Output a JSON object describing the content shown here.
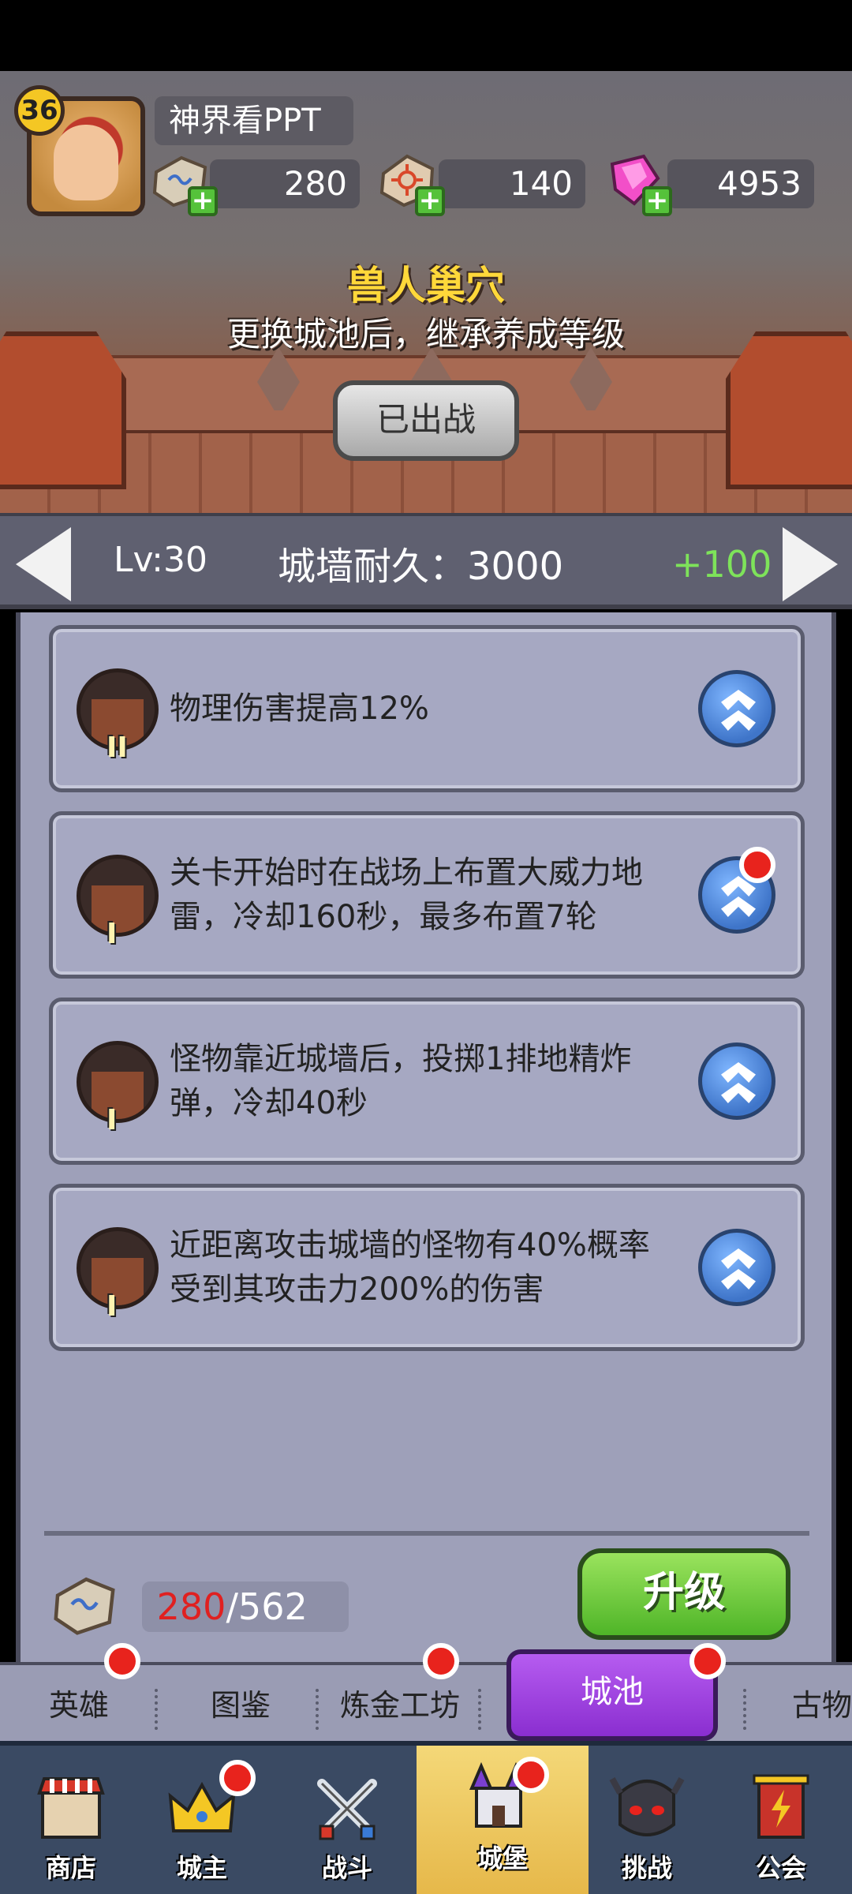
{
  "player": {
    "level": "36",
    "name": "神界看PPT"
  },
  "resources": [
    {
      "icon": "rune-stone-icon",
      "value": "280"
    },
    {
      "icon": "sun-stone-icon",
      "value": "140"
    },
    {
      "icon": "pink-gem-icon",
      "value": "4953"
    }
  ],
  "castle": {
    "title": "兽人巢穴",
    "subtitle": "更换城池后，继承养成等级",
    "deploy_label": "已出战"
  },
  "levelbar": {
    "level": "Lv:30",
    "wall": "城墙耐久：3000",
    "bonus": "+100"
  },
  "perks": [
    {
      "tier": "II",
      "text": "物理伤害提高12%",
      "has_dot": false
    },
    {
      "tier": "I",
      "text": "关卡开始时在战场上布置大威力地雷，冷却160秒，最多布置7轮",
      "has_dot": true
    },
    {
      "tier": "I",
      "text": "怪物靠近城墙后，投掷1排地精炸弹，冷却40秒",
      "has_dot": false
    },
    {
      "tier": "I",
      "text": "近距离攻击城墙的怪物有40%概率受到其攻击力200%的伤害",
      "has_dot": false
    }
  ],
  "upgrade": {
    "current": "280",
    "max": "/562",
    "button": "升级"
  },
  "subtabs": [
    "英雄",
    "图鉴",
    "炼金工坊",
    "城池",
    "古物"
  ],
  "nav": [
    "商店",
    "城主",
    "战斗",
    "城堡",
    "挑战",
    "公会"
  ],
  "colors": {
    "accent_green": "#55c23a",
    "accent_purple": "#9b3ee0",
    "badge_red": "#e8231d",
    "title_yellow": "#ffd83a"
  }
}
